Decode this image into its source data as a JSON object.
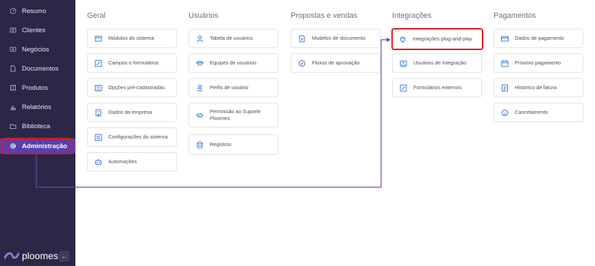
{
  "sidebar": {
    "items": [
      {
        "label": "Resumo",
        "icon": "dashboard-icon"
      },
      {
        "label": "Clientes",
        "icon": "contacts-icon"
      },
      {
        "label": "Negócios",
        "icon": "deals-icon"
      },
      {
        "label": "Documentos",
        "icon": "document-icon"
      },
      {
        "label": "Produtos",
        "icon": "product-icon"
      },
      {
        "label": "Relatórios",
        "icon": "chart-icon"
      },
      {
        "label": "Biblioteca",
        "icon": "folder-icon"
      },
      {
        "label": "Administração",
        "icon": "gear-icon",
        "active": true
      }
    ],
    "brand": "ploomes",
    "collapse_label": "←"
  },
  "columns": [
    {
      "title": "Geral",
      "items": [
        "Módulos do sistema",
        "Campos e formulários",
        "Opções pré-cadastradas",
        "Dados da empresa",
        "Configurações do sistema",
        "Automações"
      ]
    },
    {
      "title": "Usuários",
      "items": [
        "Tabela de usuários",
        "Equipes de usuários",
        "Perfis de usuário",
        "Permissão ao Suporte Ploomes",
        "Registros"
      ]
    },
    {
      "title": "Propostas e vendas",
      "items": [
        "Modelos de documento",
        "Fluxos de aprovação"
      ]
    },
    {
      "title": "Integrações",
      "items": [
        "Integrações plug-and-play",
        "Usuários de integração",
        "Formulários externos"
      ]
    },
    {
      "title": "Pagamentos",
      "items": [
        "Dados de pagamento",
        "Próximo pagamento",
        "Histórico de fatura",
        "Cancelamento"
      ]
    }
  ],
  "colors": {
    "sidebar": "#2b2847",
    "active": "#5a3fa8",
    "highlight": "#e3141c",
    "arrow": "#7a3fb0",
    "icon": "#3b77d6"
  }
}
